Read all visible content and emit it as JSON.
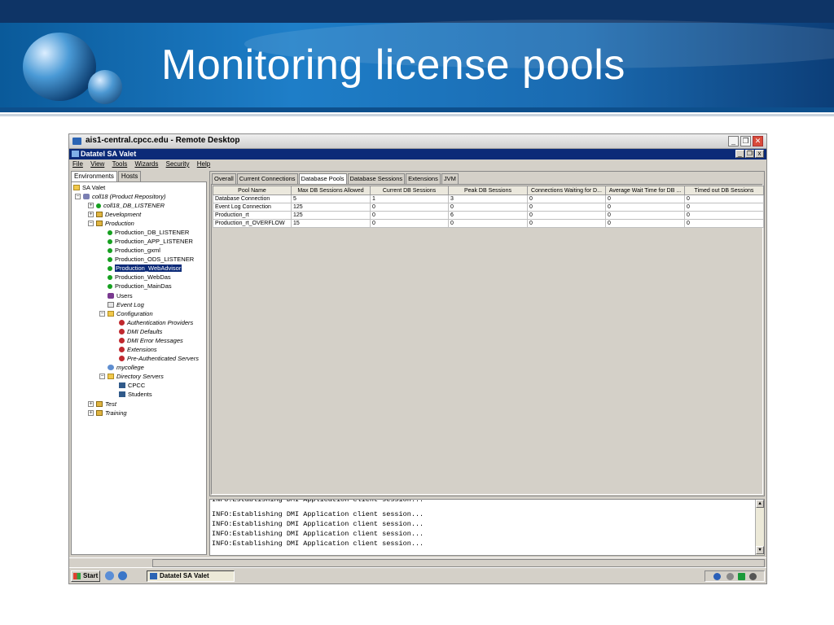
{
  "slide": {
    "title": "Monitoring license pools"
  },
  "remote_window": {
    "title": "ais1-central.cpcc.edu - Remote Desktop"
  },
  "app": {
    "title": "Datatel SA Valet",
    "menu": [
      "File",
      "View",
      "Tools",
      "Wizards",
      "Security",
      "Help"
    ]
  },
  "left_tabs": [
    "Environments",
    "Hosts"
  ],
  "tree": [
    {
      "label": "SA Valet",
      "icon": "folder-icon",
      "italic": false
    },
    {
      "label": "coll18 (Product Repository)",
      "icon": "database-icon",
      "italic": true
    },
    {
      "label": "coll18_DB_LISTENER",
      "icon": "green-status-icon",
      "italic": true
    },
    {
      "label": "Development",
      "icon": "environment-icon",
      "italic": true
    },
    {
      "label": "Production",
      "icon": "environment-icon",
      "italic": true
    },
    {
      "label": "Production_DB_LISTENER",
      "icon": "green-status-icon",
      "italic": false
    },
    {
      "label": "Production_APP_LISTENER",
      "icon": "green-status-icon",
      "italic": false
    },
    {
      "label": "Production_gxml",
      "icon": "green-status-icon",
      "italic": false
    },
    {
      "label": "Production_ODS_LISTENER",
      "icon": "green-status-icon",
      "italic": false
    },
    {
      "label": "Production_WebAdvisor",
      "icon": "green-status-icon",
      "italic": false,
      "selected": true
    },
    {
      "label": "Production_WebDas",
      "icon": "green-status-icon",
      "italic": false
    },
    {
      "label": "Production_MainDas",
      "icon": "green-status-icon",
      "italic": false
    },
    {
      "label": "Users",
      "icon": "users-icon",
      "italic": false
    },
    {
      "label": "Event Log",
      "icon": "log-icon",
      "italic": true
    },
    {
      "label": "Configuration",
      "icon": "folder-icon",
      "italic": true
    },
    {
      "label": "Authentication Providers",
      "icon": "gear-icon",
      "italic": true
    },
    {
      "label": "DMI Defaults",
      "icon": "gear-icon",
      "italic": true
    },
    {
      "label": "DMI Error Messages",
      "icon": "gear-icon",
      "italic": true
    },
    {
      "label": "Extensions",
      "icon": "gear-icon",
      "italic": true
    },
    {
      "label": "Pre-Authenticated Servers",
      "icon": "gear-icon",
      "italic": true
    },
    {
      "label": "mycollege",
      "icon": "globe-icon",
      "italic": true
    },
    {
      "label": "Directory Servers",
      "icon": "folder-icon",
      "italic": true
    },
    {
      "label": "CPCC",
      "icon": "server-icon",
      "italic": false
    },
    {
      "label": "Students",
      "icon": "server-icon",
      "italic": false
    },
    {
      "label": "Test",
      "icon": "environment-icon",
      "italic": true
    },
    {
      "label": "Training",
      "icon": "environment-icon",
      "italic": true
    }
  ],
  "right_tabs": [
    "Overall",
    "Current Connections",
    "Database Pools",
    "Database Sessions",
    "Extensions",
    "JVM"
  ],
  "right_tab_selected": 2,
  "pool_table": {
    "columns": [
      "Pool Name",
      "Max DB Sessions Allowed",
      "Current DB Sessions",
      "Peak DB Sessions",
      "Connections Waiting for D...",
      "Average Wait Time for DB ...",
      "Timed out DB Sessions"
    ],
    "rows": [
      [
        "Database Connection",
        "5",
        "1",
        "3",
        "0",
        "0",
        "0"
      ],
      [
        "Event Log Connection",
        "125",
        "0",
        "0",
        "0",
        "0",
        "0"
      ],
      [
        "Production_rt",
        "125",
        "0",
        "6",
        "0",
        "0",
        "0"
      ],
      [
        "Production_rt_OVERFLOW",
        "15",
        "0",
        "0",
        "0",
        "0",
        "0"
      ]
    ]
  },
  "console": {
    "lines": [
      "INFO:Establishing DMI Application client session...",
      "INFO:Establishing DMI Application client session...",
      "INFO:Establishing DMI Application client session...",
      "INFO:Establishing DMI Application client session...",
      "INFO:Establishing DMI Application client session..."
    ]
  },
  "taskbar": {
    "start_label": "Start",
    "task_item": "Datatel SA Valet"
  }
}
